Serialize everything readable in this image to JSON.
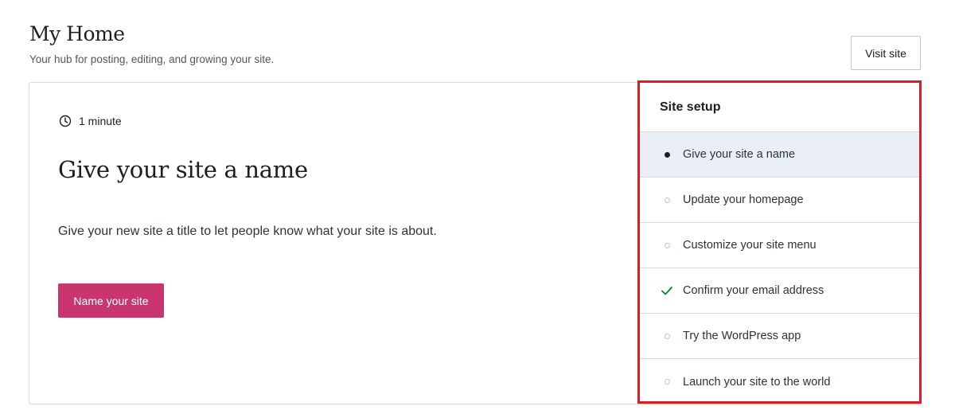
{
  "header": {
    "title": "My Home",
    "subtitle": "Your hub for posting, editing, and growing your site.",
    "visit_site_label": "Visit site"
  },
  "task": {
    "time_estimate": "1 minute",
    "title": "Give your site a name",
    "description": "Give your new site a title to let people know what your site is about.",
    "action_label": "Name your site"
  },
  "setup": {
    "title": "Site setup",
    "items": [
      {
        "label": "Give your site a name",
        "status": "current"
      },
      {
        "label": "Update your homepage",
        "status": "pending"
      },
      {
        "label": "Customize your site menu",
        "status": "pending"
      },
      {
        "label": "Confirm your email address",
        "status": "completed"
      },
      {
        "label": "Try the WordPress app",
        "status": "pending"
      },
      {
        "label": "Launch your site to the world",
        "status": "pending"
      }
    ]
  },
  "colors": {
    "accent_button": "#c9356e",
    "highlight_border": "#e01b24",
    "active_row_bg": "#e9eff5",
    "check_green": "#008a20"
  }
}
